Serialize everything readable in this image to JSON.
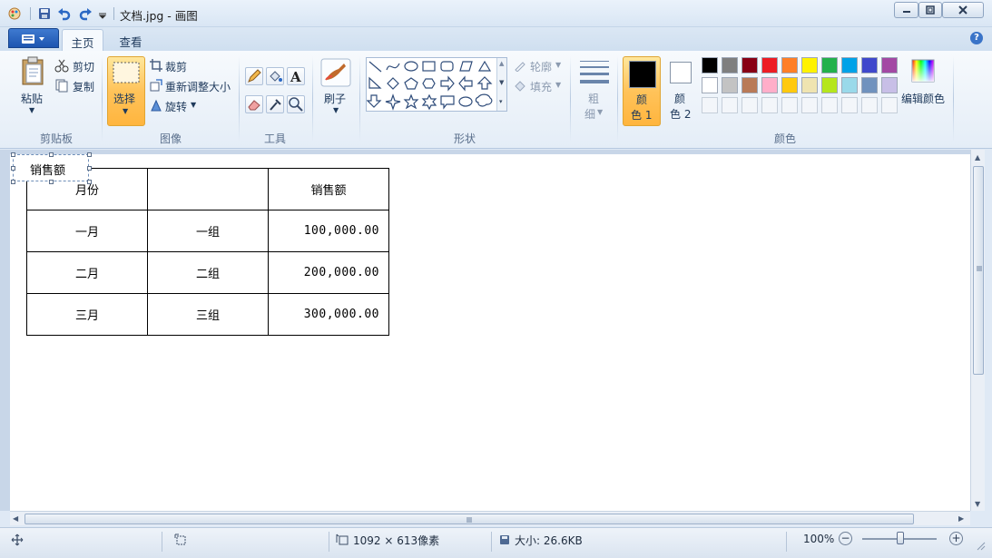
{
  "window": {
    "title": "文档.jpg - 画图"
  },
  "tabs": {
    "home": "主页",
    "view": "查看"
  },
  "ribbon": {
    "clipboard": {
      "paste": "粘贴",
      "cut": "剪切",
      "copy": "复制",
      "label": "剪贴板"
    },
    "image": {
      "select": "选择",
      "crop": "裁剪",
      "resize": "重新调整大小",
      "rotate": "旋转",
      "label": "图像"
    },
    "tools": {
      "label": "工具"
    },
    "brushes": {
      "label": "刷子"
    },
    "shapes": {
      "outline": "轮廓",
      "fill": "填充",
      "label": "形状"
    },
    "size": {
      "line1": "粗",
      "line2": "细"
    },
    "colors": {
      "color1_line1": "颜",
      "color1_line2": "色 1",
      "color2_line1": "颜",
      "color2_line2": "色 2",
      "edit": "编辑颜色",
      "label": "颜色",
      "primary": "#000000",
      "secondary": "#ffffff",
      "palette_row1": [
        "#000000",
        "#7f7f7f",
        "#880015",
        "#ed1c24",
        "#ff7f27",
        "#fff200",
        "#22b14c",
        "#00a2e8",
        "#3f48cc",
        "#a349a4"
      ],
      "palette_row2": [
        "#ffffff",
        "#c3c3c3",
        "#b97a57",
        "#ffaec9",
        "#ffc90e",
        "#efe4b0",
        "#b5e61d",
        "#99d9ea",
        "#7092be",
        "#c8bfe7"
      ]
    }
  },
  "canvas": {
    "selection_text": "销售额",
    "table": [
      [
        "月份",
        "",
        "销售额"
      ],
      [
        "一月",
        "一组",
        "100,000.00"
      ],
      [
        "二月",
        "二组",
        "200,000.00"
      ],
      [
        "三月",
        "三组",
        "300,000.00"
      ]
    ]
  },
  "status": {
    "dimensions": "1092 × 613像素",
    "size": "大小: 26.6KB",
    "zoom": "100%"
  }
}
